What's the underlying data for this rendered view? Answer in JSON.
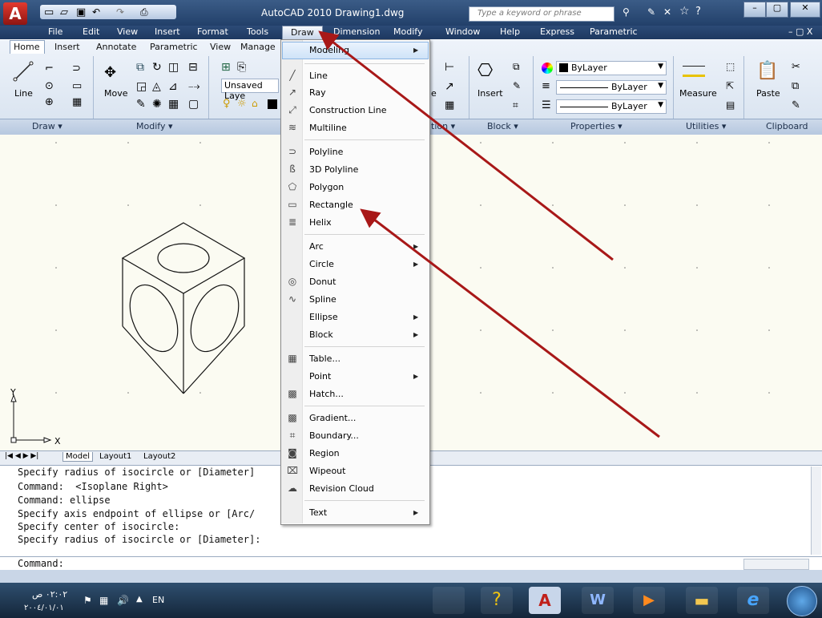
{
  "app": {
    "title": "AutoCAD 2010",
    "document": "Drawing1.dwg",
    "search_placeholder": "Type a keyword or phrase"
  },
  "menubar": {
    "items": [
      "File",
      "Edit",
      "View",
      "Insert",
      "Format",
      "Tools",
      "Draw",
      "Dimension",
      "Modify",
      "Window",
      "Help",
      "Express",
      "Parametric"
    ]
  },
  "ribbon": {
    "tabs": [
      "Home",
      "Insert",
      "Annotate",
      "Parametric",
      "View",
      "Manage"
    ],
    "buttons": {
      "line": "Line",
      "move": "Move",
      "insert": "Insert",
      "measure": "Measure",
      "paste": "Paste",
      "unsaved_layer": "Unsaved Laye",
      "bylayer1": "ByLayer",
      "bylayer2": "ByLayer",
      "bylayer3": "ByLayer",
      "annotation_fragment_e": "e"
    },
    "panels": [
      "Draw",
      "Modify",
      "tion",
      "Block",
      "Properties",
      "Utilities",
      "Clipboard"
    ]
  },
  "draw_menu": {
    "items": [
      {
        "label": "Modeling",
        "submenu": true
      },
      {
        "label": "Line"
      },
      {
        "label": "Ray"
      },
      {
        "label": "Construction Line"
      },
      {
        "label": "Multiline"
      },
      {
        "label": "Polyline"
      },
      {
        "label": "3D Polyline"
      },
      {
        "label": "Polygon"
      },
      {
        "label": "Rectangle"
      },
      {
        "label": "Helix"
      },
      {
        "label": "Arc",
        "submenu": true
      },
      {
        "label": "Circle",
        "submenu": true
      },
      {
        "label": "Donut"
      },
      {
        "label": "Spline"
      },
      {
        "label": "Ellipse",
        "submenu": true
      },
      {
        "label": "Block",
        "submenu": true
      },
      {
        "label": "Table..."
      },
      {
        "label": "Point",
        "submenu": true
      },
      {
        "label": "Hatch..."
      },
      {
        "label": "Gradient..."
      },
      {
        "label": "Boundary..."
      },
      {
        "label": "Region"
      },
      {
        "label": "Wipeout"
      },
      {
        "label": "Revision Cloud"
      },
      {
        "label": "Text",
        "submenu": true
      }
    ]
  },
  "layout_tabs": [
    "Model",
    "Layout1",
    "Layout2"
  ],
  "ucs": {
    "x_label": "X",
    "y_label": "Y"
  },
  "command_history": [
    "Specify radius of isocircle or [Diameter]",
    "Command:  <Isoplane Right>",
    "Command: ellipse",
    "Specify axis endpoint of ellipse or [Arc/",
    "Specify center of isocircle:",
    "Specify radius of isocircle or [Diameter]:"
  ],
  "command_prompt": "Command:",
  "taskbar": {
    "time": "٠٢:٠٢ ص",
    "date": "٢٠٠٤/٠١/٠١",
    "lang": "EN"
  },
  "colors": {
    "arrow": "#a81818",
    "canvas": "#fbfbf2",
    "title_bar": "#22406a"
  }
}
